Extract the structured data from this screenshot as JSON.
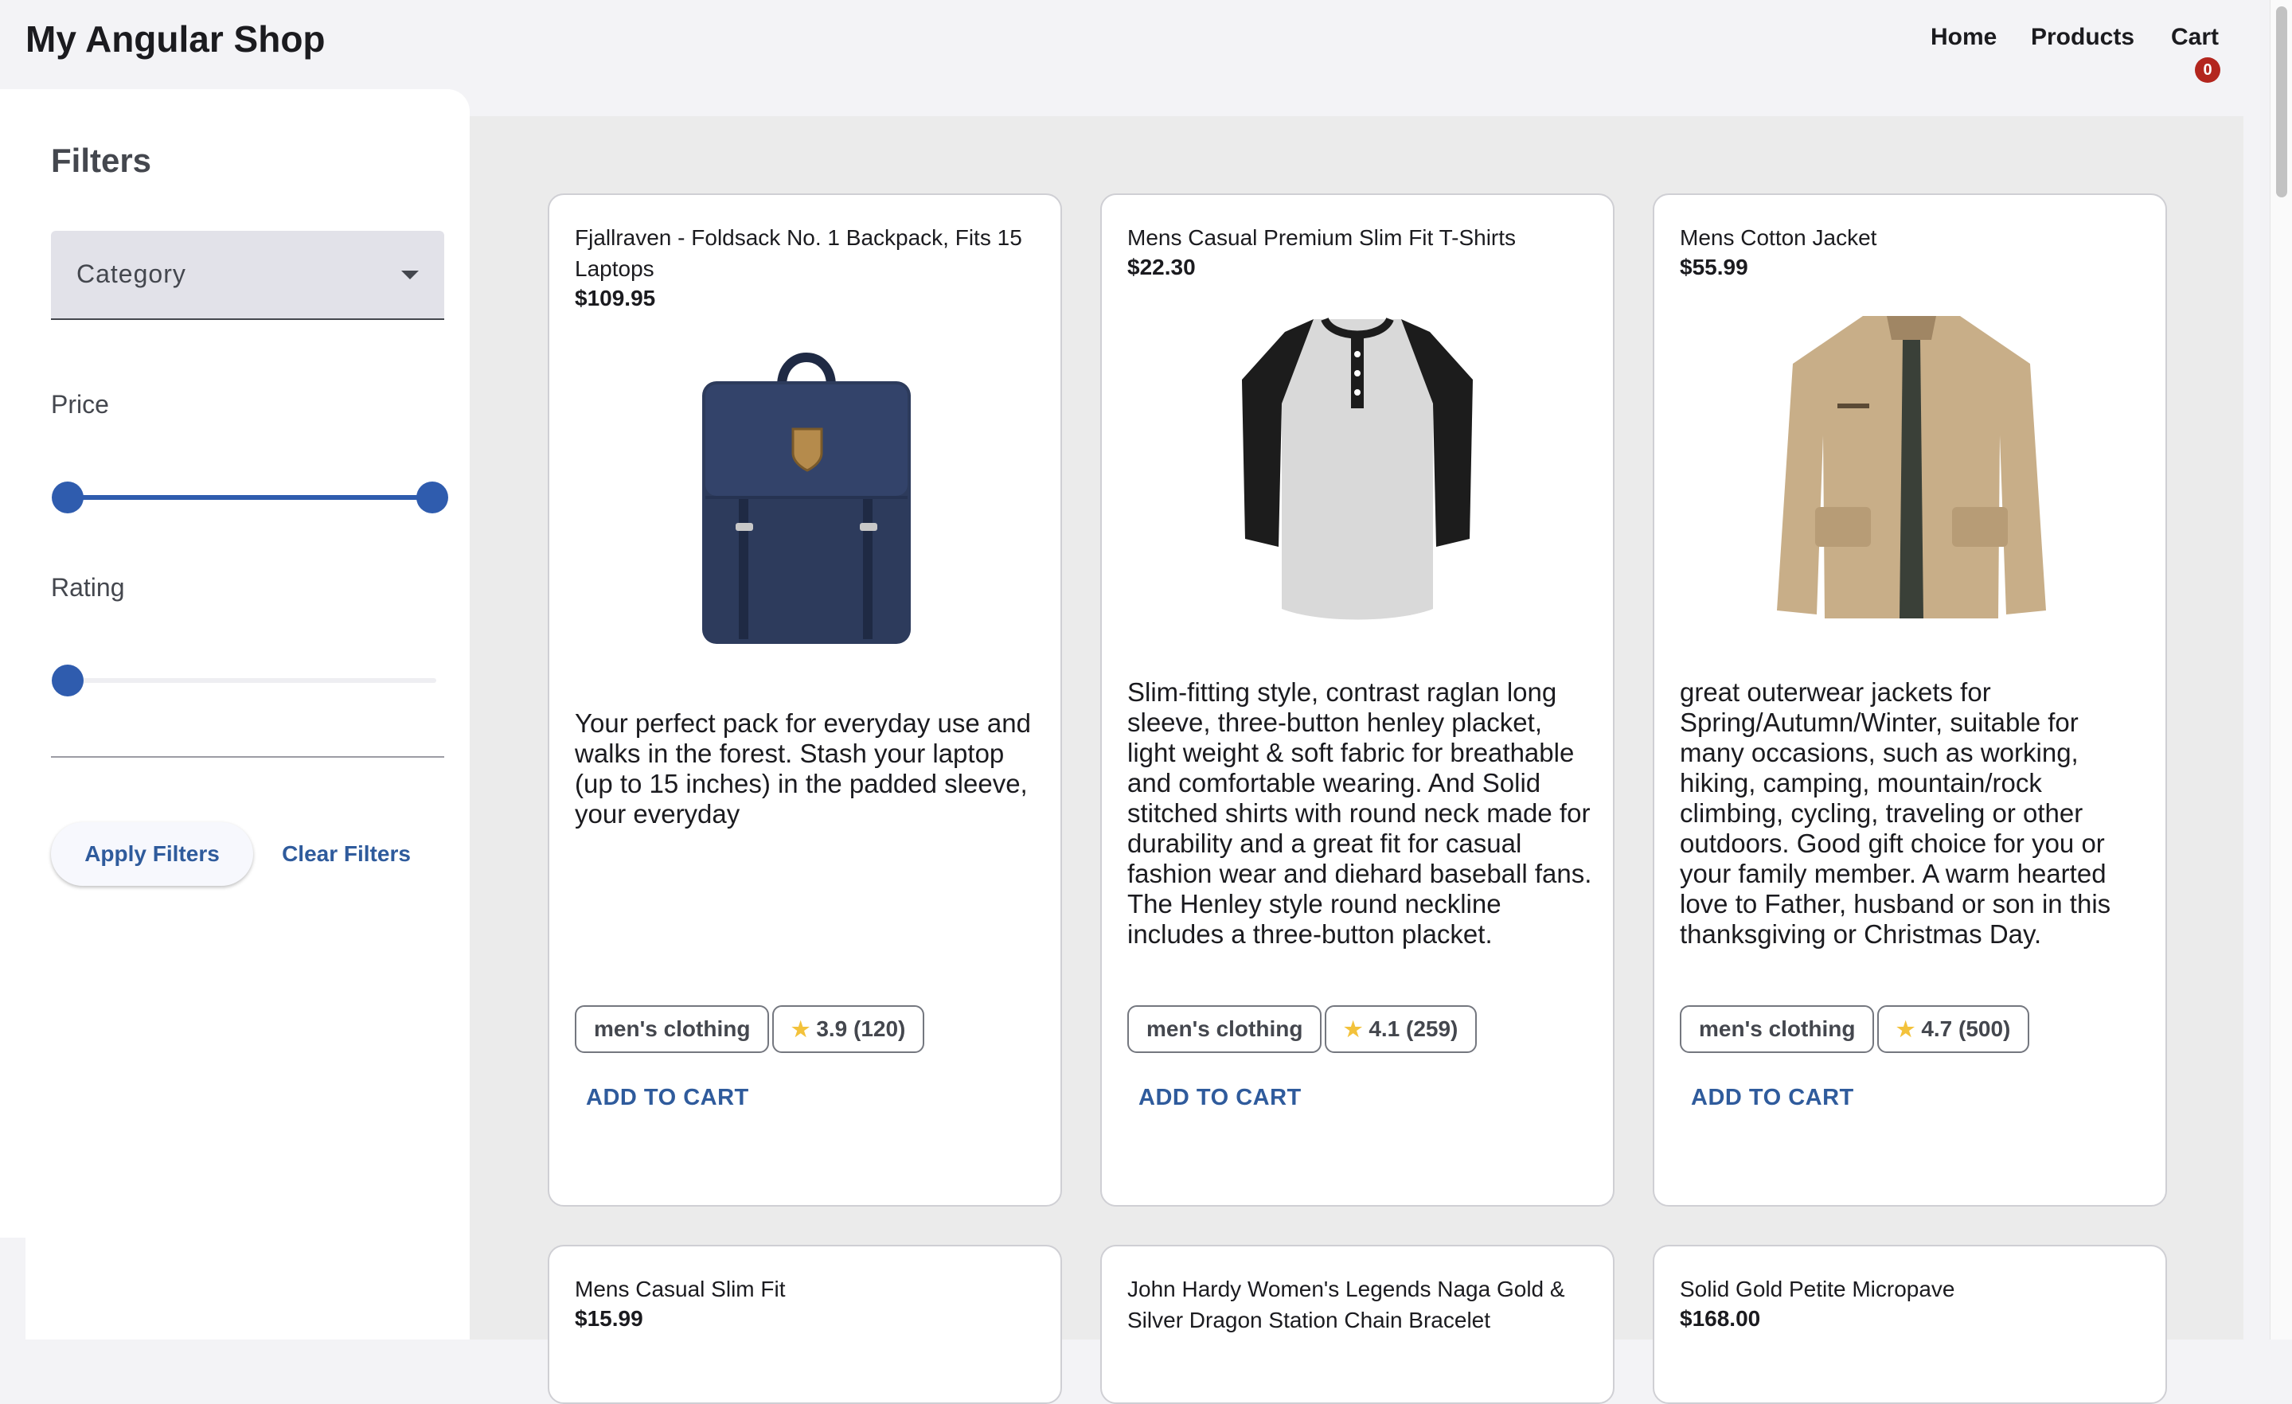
{
  "header": {
    "brand": "My Angular Shop",
    "nav": {
      "home": "Home",
      "products": "Products",
      "cart": "Cart"
    },
    "cart_count": "0"
  },
  "filters": {
    "title": "Filters",
    "category": {
      "placeholder": "Category"
    },
    "price_label": "Price",
    "rating_label": "Rating",
    "price_range": {
      "min_fraction": 0,
      "max_fraction": 1
    },
    "rating_value_fraction": 0,
    "apply_label": "Apply Filters",
    "clear_label": "Clear Filters"
  },
  "products": [
    {
      "title": "Fjallraven - Foldsack No. 1 Backpack, Fits 15 Laptops",
      "price": "$109.95",
      "description": "Your perfect pack for everyday use and walks in the forest. Stash your laptop (up to 15 inches) in the padded sleeve, your everyday",
      "category": "men's clothing",
      "rating": "3.9 (120)",
      "add_label": "ADD TO CART",
      "image": "backpack"
    },
    {
      "title": "Mens Casual Premium Slim Fit T-Shirts",
      "price": "$22.30",
      "description": "Slim-fitting style, contrast raglan long sleeve, three-button henley placket, light weight & soft fabric for breathable and comfortable wearing. And Solid stitched shirts with round neck made for durability and a great fit for casual fashion wear and diehard baseball fans. The Henley style round neckline includes a three-button placket.",
      "category": "men's clothing",
      "rating": "4.1 (259)",
      "add_label": "ADD TO CART",
      "image": "t-shirt"
    },
    {
      "title": "Mens Cotton Jacket",
      "price": "$55.99",
      "description": "great outerwear jackets for Spring/Autumn/Winter, suitable for many occasions, such as working, hiking, camping, mountain/rock climbing, cycling, traveling or other outdoors. Good gift choice for you or your family member. A warm hearted love to Father, husband or son in this thanksgiving or Christmas Day.",
      "category": "men's clothing",
      "rating": "4.7 (500)",
      "add_label": "ADD TO CART",
      "image": "jacket"
    },
    {
      "title": "Mens Casual Slim Fit",
      "price": "$15.99"
    },
    {
      "title": "John Hardy Women's Legends Naga Gold & Silver Dragon Station Chain Bracelet",
      "price": ""
    },
    {
      "title": "Solid Gold Petite Micropave",
      "price": "$168.00"
    }
  ],
  "icons": {
    "star": "star-icon",
    "dropdown": "chevron-down-icon"
  },
  "colors": {
    "accent": "#2f5cae",
    "badge": "#b3261e",
    "link": "#2f5b9c"
  }
}
